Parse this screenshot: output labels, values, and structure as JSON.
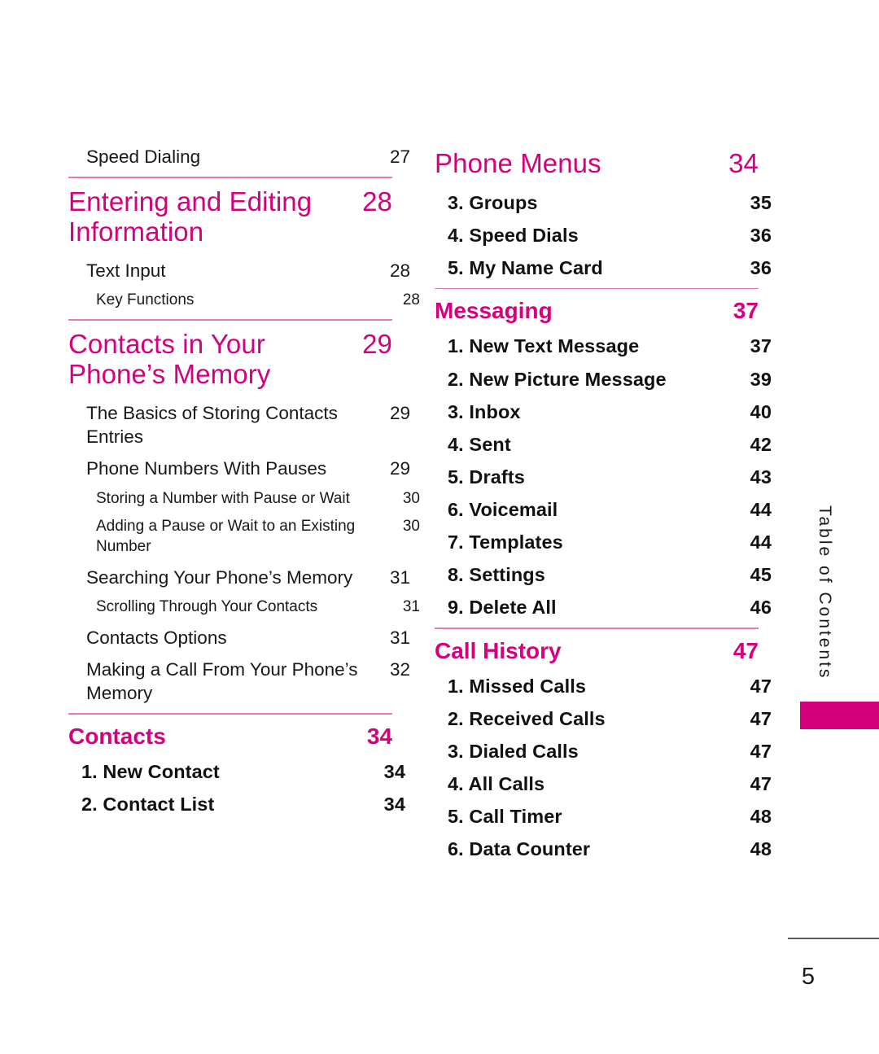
{
  "document": {
    "side_label": "Table of Contents",
    "page_number": "5",
    "accent_color": "#D4007D",
    "rule_color": "#E87BB4",
    "text_color": "#181818"
  },
  "left_column": [
    {
      "kind": "entry",
      "label": "Speed Dialing",
      "page": "27"
    },
    {
      "kind": "rule"
    },
    {
      "kind": "chapter",
      "label": "Entering and Editing Information",
      "page": "28"
    },
    {
      "kind": "entry",
      "label": "Text Input",
      "page": "28"
    },
    {
      "kind": "sub",
      "label": "Key Functions",
      "page": "28"
    },
    {
      "kind": "rule"
    },
    {
      "kind": "chapter",
      "label": "Contacts in Your Phone’s Memory",
      "page": "29"
    },
    {
      "kind": "entry",
      "label": "The Basics of Storing Contacts Entries",
      "page": "29"
    },
    {
      "kind": "entry",
      "label": "Phone Numbers With Pauses",
      "page": "29"
    },
    {
      "kind": "sub",
      "label": "Storing a Number with Pause or Wait",
      "page": "30"
    },
    {
      "kind": "sub",
      "label": "Adding a Pause or Wait to an Existing Number",
      "page": "30"
    },
    {
      "kind": "entry",
      "label": "Searching Your Phone’s Memory",
      "page": "31"
    },
    {
      "kind": "sub",
      "label": "Scrolling Through Your Contacts",
      "page": "31"
    },
    {
      "kind": "entry",
      "label": "Contacts Options",
      "page": "31"
    },
    {
      "kind": "entry",
      "label": "Making a Call From Your Phone’s Memory",
      "page": "32"
    },
    {
      "kind": "rule"
    },
    {
      "kind": "section",
      "label": "Contacts",
      "page": "34"
    },
    {
      "kind": "numbered",
      "label": "1. New Contact",
      "page": "34"
    },
    {
      "kind": "numbered",
      "label": "2. Contact List",
      "page": "34"
    }
  ],
  "right_column": [
    {
      "kind": "chapter",
      "label": "Phone Menus",
      "page": "34"
    },
    {
      "kind": "numbered",
      "label": "3. Groups",
      "page": "35"
    },
    {
      "kind": "numbered",
      "label": "4. Speed Dials",
      "page": "36"
    },
    {
      "kind": "numbered",
      "label": "5. My Name Card",
      "page": "36"
    },
    {
      "kind": "rule"
    },
    {
      "kind": "section",
      "label": "Messaging",
      "page": "37"
    },
    {
      "kind": "numbered",
      "label": "1. New Text Message",
      "page": "37"
    },
    {
      "kind": "numbered",
      "label": "2. New Picture Message",
      "page": "39"
    },
    {
      "kind": "numbered",
      "label": "3. Inbox",
      "page": "40"
    },
    {
      "kind": "numbered",
      "label": "4. Sent",
      "page": "42"
    },
    {
      "kind": "numbered",
      "label": "5. Drafts",
      "page": "43"
    },
    {
      "kind": "numbered",
      "label": "6. Voicemail",
      "page": "44"
    },
    {
      "kind": "numbered",
      "label": "7. Templates",
      "page": "44"
    },
    {
      "kind": "numbered",
      "label": "8. Settings",
      "page": "45"
    },
    {
      "kind": "numbered",
      "label": "9. Delete All",
      "page": "46"
    },
    {
      "kind": "rule"
    },
    {
      "kind": "section",
      "label": "Call History",
      "page": "47"
    },
    {
      "kind": "numbered",
      "label": "1. Missed Calls",
      "page": "47"
    },
    {
      "kind": "numbered",
      "label": "2. Received Calls",
      "page": "47"
    },
    {
      "kind": "numbered",
      "label": "3. Dialed Calls",
      "page": "47"
    },
    {
      "kind": "numbered",
      "label": "4. All Calls",
      "page": "47"
    },
    {
      "kind": "numbered",
      "label": "5. Call Timer",
      "page": "48"
    },
    {
      "kind": "numbered",
      "label": "6. Data Counter",
      "page": "48"
    }
  ]
}
